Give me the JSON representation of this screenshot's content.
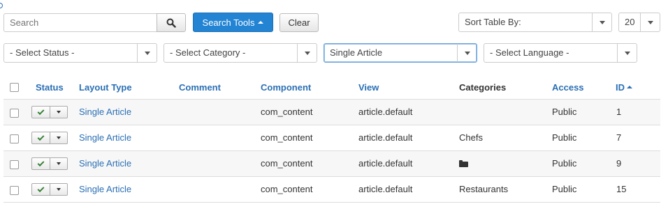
{
  "toolbar": {
    "search_placeholder": "Search",
    "search_tools_label": "Search Tools",
    "clear_label": "Clear",
    "sort_label": "Sort Table By:",
    "limit_value": "20"
  },
  "filters": {
    "status": "- Select Status -",
    "category": "- Select Category -",
    "layout_type": "Single Article",
    "language": "- Select Language -"
  },
  "table": {
    "headers": {
      "status": "Status",
      "layout_type": "Layout Type",
      "comment": "Comment",
      "component": "Component",
      "view": "View",
      "categories": "Categories",
      "access": "Access",
      "id": "ID"
    },
    "sort_column": "ID",
    "sort_direction": "ascending",
    "rows": [
      {
        "status": "published",
        "layout_type": "Single Article",
        "comment": "",
        "component": "com_content",
        "view": "article.default",
        "categories": "",
        "access": "Public",
        "id": "1"
      },
      {
        "status": "published",
        "layout_type": "Single Article",
        "comment": "",
        "component": "com_content",
        "view": "article.default",
        "categories": "Chefs",
        "access": "Public",
        "id": "7"
      },
      {
        "status": "published",
        "layout_type": "Single Article",
        "comment": "",
        "component": "com_content",
        "view": "article.default",
        "categories": "",
        "categories_icon": "folder-open-icon",
        "access": "Public",
        "id": "9"
      },
      {
        "status": "published",
        "layout_type": "Single Article",
        "comment": "",
        "component": "com_content",
        "view": "article.default",
        "categories": "Restaurants",
        "access": "Public",
        "id": "15"
      }
    ]
  },
  "colors": {
    "accent": "#2384d3",
    "link": "#2a6fb5",
    "published_check": "#378137",
    "row_stripe": "#f7f7f7"
  },
  "icons": {
    "search_button": "search-icon",
    "search_tools_caret": "caret-up-icon",
    "select_arrow": "caret-down-icon",
    "status_check": "check-icon"
  }
}
